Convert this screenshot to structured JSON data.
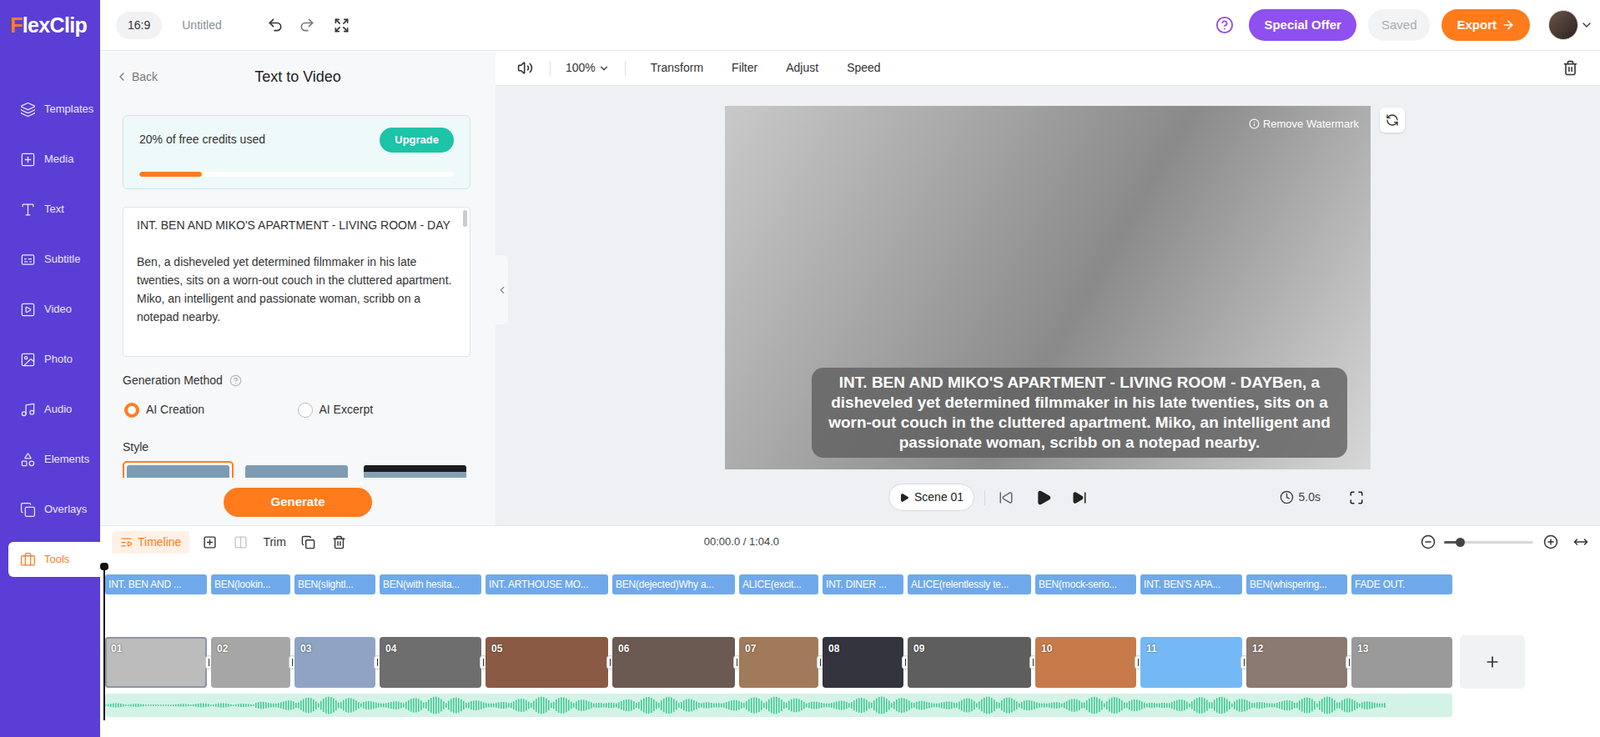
{
  "app": {
    "logo": {
      "first": "F",
      "rest": "lexClip"
    }
  },
  "header": {
    "aspect": "16:9",
    "title": "Untitled",
    "special_offer": "Special Offer",
    "save_status": "Saved",
    "export": "Export"
  },
  "sidebar": {
    "items": [
      {
        "label": "Templates",
        "selected": false
      },
      {
        "label": "Media",
        "selected": false
      },
      {
        "label": "Text",
        "selected": false
      },
      {
        "label": "Subtitle",
        "selected": false
      },
      {
        "label": "Video",
        "selected": false
      },
      {
        "label": "Photo",
        "selected": false
      },
      {
        "label": "Audio",
        "selected": false
      },
      {
        "label": "Elements",
        "selected": false
      },
      {
        "label": "Overlays",
        "selected": false
      },
      {
        "label": "Tools",
        "selected": true
      }
    ]
  },
  "panel": {
    "back": "Back",
    "title": "Text to Video",
    "credits": {
      "text": "20% of free credits used",
      "level": 0.2,
      "upgrade": "Upgrade"
    },
    "script": {
      "heading": "INT. BEN AND MIKO'S APARTMENT - LIVING ROOM - DAY",
      "body": "Ben, a disheveled yet determined filmmaker in his late twenties, sits on a worn-out couch in the cluttered apartment. Miko, an intelligent and passionate woman, scribb on a notepad nearby."
    },
    "generation_method": {
      "label": "Generation Method",
      "options": [
        {
          "label": "AI Creation",
          "selected": true
        },
        {
          "label": "AI Excerpt",
          "selected": false
        }
      ]
    },
    "style": {
      "label": "Style",
      "options": [
        {
          "kind": "light",
          "selected": true
        },
        {
          "kind": "light",
          "selected": false
        },
        {
          "kind": "dark",
          "selected": false
        }
      ]
    },
    "generate": "Generate"
  },
  "preview": {
    "toolbar": {
      "zoom": "100%",
      "tools": [
        "Transform",
        "Filter",
        "Adjust",
        "Speed"
      ]
    },
    "watermark": "Remove Watermark",
    "caption": "INT. BEN AND MIKO'S APARTMENT - LIVING ROOM - DAYBen, a disheveled yet determined filmmaker in his late twenties, sits on a worn-out couch in the cluttered apartment. Miko, an intelligent and passionate woman, scribb on a notepad nearby.",
    "scene": "Scene 01",
    "duration": "5.0s"
  },
  "timeline": {
    "label": "Timeline",
    "trim": "Trim",
    "time": "00:00.0 / 1:04.0",
    "zoom_level": 0.18,
    "split_disabled": true,
    "subtitles": [
      "INT. BEN AND ...",
      "BEN(lookin...",
      "BEN(slightl...",
      "BEN(with hesita...",
      "INT. ARTHOUSE MO...",
      "BEN(dejected)Why a...",
      "ALICE(excit...",
      "INT. DINER ...",
      "ALICE(relentlessly te...",
      "BEN(mock-serio...",
      "INT. BEN'S APA...",
      "BEN(whispering...",
      "FADE OUT."
    ],
    "scenes": [
      {
        "number": "01",
        "kind": "photo",
        "selected": true
      },
      {
        "number": "02",
        "kind": "photo",
        "selected": false
      },
      {
        "number": "03",
        "kind": "photo",
        "selected": false
      },
      {
        "number": "04",
        "kind": "photo",
        "selected": false
      },
      {
        "number": "05",
        "kind": "photo",
        "selected": false
      },
      {
        "number": "06",
        "kind": "photo",
        "selected": false
      },
      {
        "number": "07",
        "kind": "photo",
        "selected": false
      },
      {
        "number": "08",
        "kind": "photo",
        "selected": false
      },
      {
        "number": "09",
        "kind": "photo",
        "selected": false
      },
      {
        "number": "10",
        "kind": "photo",
        "selected": false
      },
      {
        "number": "11",
        "kind": "color",
        "selected": false
      },
      {
        "number": "12",
        "kind": "photo",
        "selected": false
      },
      {
        "number": "13",
        "kind": "photo",
        "selected": false
      }
    ]
  }
}
